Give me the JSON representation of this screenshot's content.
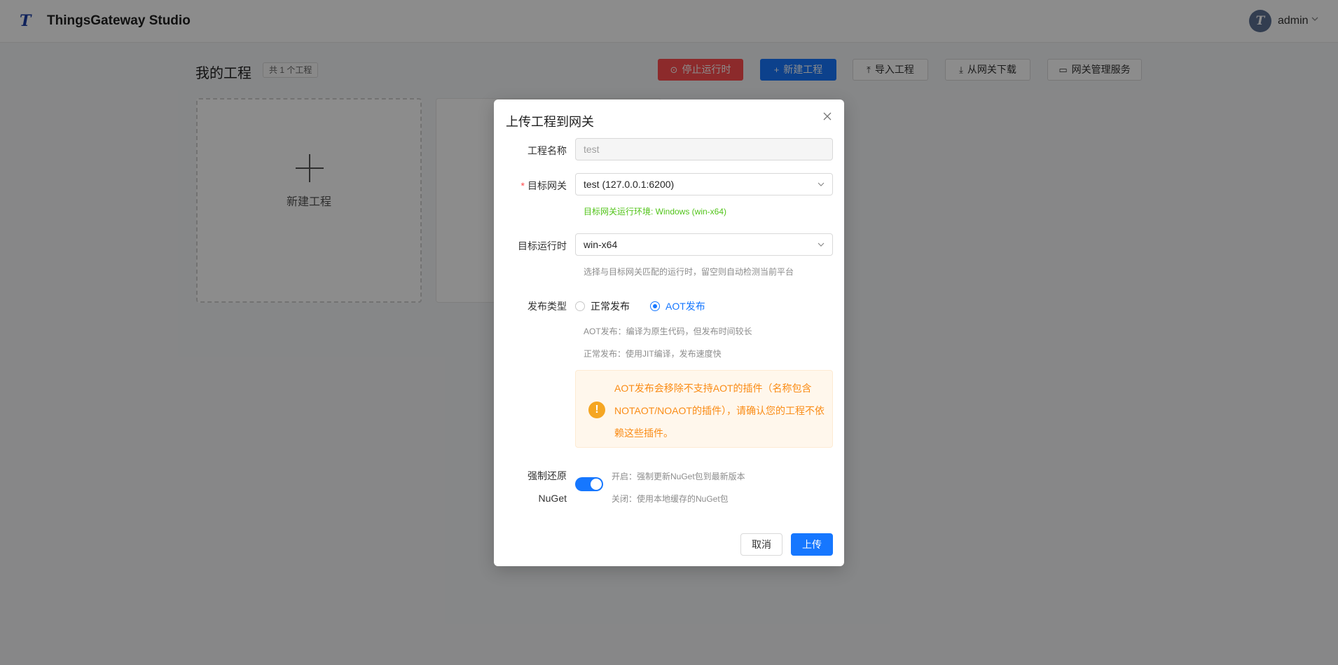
{
  "header": {
    "app_title": "ThingsGateway Studio",
    "logo_letter": "T",
    "user": {
      "avatar_letter": "T",
      "name": "admin"
    }
  },
  "toolbar": {
    "page_title": "我的工程",
    "project_count": "共 1 个工程",
    "stop_runtime": "停止运行时",
    "new_project": "新建工程",
    "import_project": "导入工程",
    "download_from_gateway": "从网关下载",
    "gateway_management": "网关管理服务"
  },
  "cards": {
    "new_project_label": "新建工程"
  },
  "modal": {
    "title": "上传工程到网关",
    "project_name": {
      "label": "工程名称",
      "value": "test"
    },
    "target_gateway": {
      "label": "目标网关",
      "required_mark": "*",
      "value": "test (127.0.0.1:6200)",
      "env_hint": "目标网关运行环境: Windows (win-x64)"
    },
    "target_runtime": {
      "label": "目标运行时",
      "value": "win-x64",
      "hint": "选择与目标网关匹配的运行时，留空则自动检测当前平台"
    },
    "publish_type": {
      "label": "发布类型",
      "options": [
        "正常发布",
        "AOT发布"
      ],
      "selected": "AOT发布",
      "aot_hint": "AOT发布：编译为原生代码，但发布时间较长",
      "normal_hint": "正常发布：使用JIT编译，发布速度快"
    },
    "warning": {
      "icon": "!",
      "text": "AOT发布会移除不支持AOT的插件（名称包含NOTAOT/NOAOT的插件），请确认您的工程不依赖这些插件。"
    },
    "force_restore": {
      "label_line1": "强制还原",
      "label_line2": "NuGet",
      "enabled": true,
      "on_hint": "开启：强制更新NuGet包到最新版本",
      "off_hint": "关闭：使用本地缓存的NuGet包"
    },
    "cancel": "取消",
    "upload": "上传"
  },
  "colors": {
    "primary": "#1677ff",
    "danger": "#ff4d4f",
    "success": "#52c41a",
    "warning": "#fa8c16"
  }
}
